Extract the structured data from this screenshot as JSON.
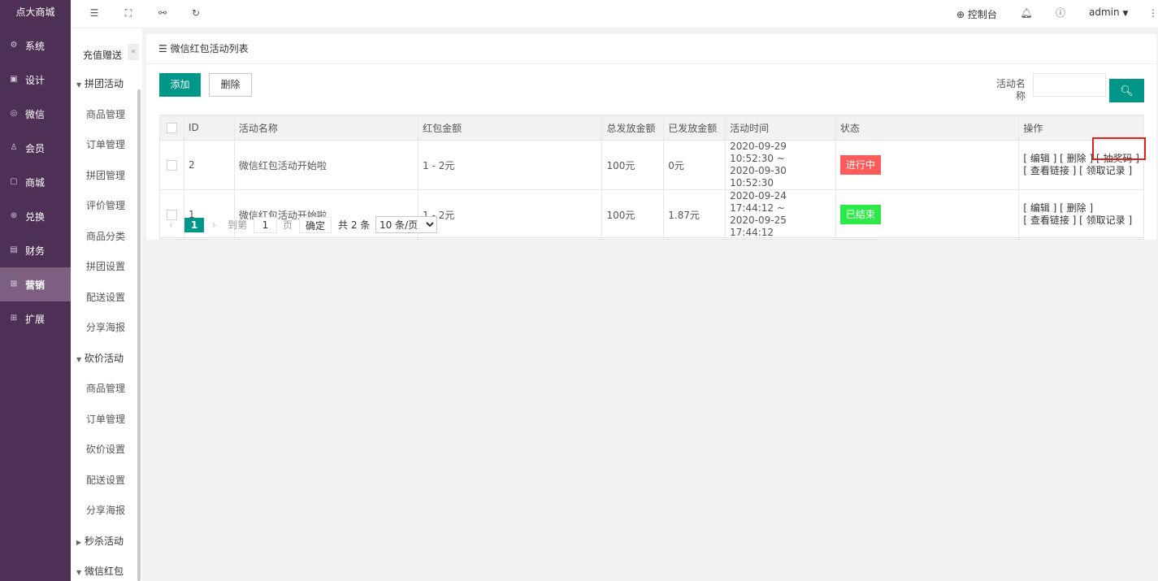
{
  "app": {
    "brand": "点大商城"
  },
  "nav": {
    "items": [
      {
        "label": "系统",
        "icon": "gear-icon",
        "glyph": "⚙"
      },
      {
        "label": "设计",
        "icon": "design-icon",
        "glyph": "▣"
      },
      {
        "label": "微信",
        "icon": "wechat-icon",
        "glyph": "◎"
      },
      {
        "label": "会员",
        "icon": "user-icon",
        "glyph": "♙"
      },
      {
        "label": "商城",
        "icon": "shop-icon",
        "glyph": "▢"
      },
      {
        "label": "兑换",
        "icon": "exchange-icon",
        "glyph": "⊛"
      },
      {
        "label": "财务",
        "icon": "finance-icon",
        "glyph": "▤"
      },
      {
        "label": "营销",
        "icon": "gift-icon",
        "glyph": "⊞"
      },
      {
        "label": "扩展",
        "icon": "apps-icon",
        "glyph": "⊞"
      }
    ],
    "active_index": 7
  },
  "submenu": {
    "top_label": "充值赠送",
    "collapse_glyph": "«",
    "group1": {
      "label": "拼团活动",
      "items": [
        "商品管理",
        "订单管理",
        "拼团管理",
        "评价管理",
        "商品分类",
        "拼团设置",
        "配送设置",
        "分享海报"
      ]
    },
    "group2": {
      "label": "砍价活动",
      "items": [
        "商品管理",
        "订单管理",
        "砍价设置",
        "配送设置",
        "分享海报"
      ]
    },
    "group3": {
      "label": "秒杀活动"
    },
    "group4": {
      "label": "微信红包"
    }
  },
  "topbar": {
    "console_label": "控制台",
    "user_label": "admin"
  },
  "card": {
    "title": "微信红包活动列表",
    "add_label": "添加",
    "delete_label": "删除",
    "search_label": "活动名称",
    "search_value": ""
  },
  "table": {
    "headers": [
      "ID",
      "活动名称",
      "红包金额",
      "总发放金额",
      "已发放金额",
      "活动时间",
      "状态",
      "操作"
    ],
    "rows": [
      {
        "id": "2",
        "name": "微信红包活动开始啦",
        "amount": "1 - 2元",
        "total": "100元",
        "issued": "0元",
        "time_start": "2020-09-29 10:52:30 ~",
        "time_end": "2020-09-30 10:52:30",
        "status": "进行中",
        "status_color": "#ff5722",
        "op_edit": "[ 编辑 ]",
        "op_delete": "[ 删除 ]",
        "op_code": "[ 抽奖码 ]",
        "op_link": "[ 查看链接 ]",
        "op_records": "[ 领取记录 ]"
      },
      {
        "id": "1",
        "name": "微信红包活动开始啦",
        "amount": "1 - 2元",
        "total": "100元",
        "issued": "1.87元",
        "time_start": "2020-09-24 17:44:12 ~",
        "time_end": "2020-09-25 17:44:12",
        "status": "已结束",
        "status_color": "#2ee94a",
        "op_edit": "[ 编辑 ]",
        "op_delete": "[ 删除 ]",
        "op_link": "[ 查看链接 ]",
        "op_records": "[ 领取记录 ]"
      }
    ]
  },
  "pager": {
    "current": "1",
    "goto_label": "到第",
    "goto_value": "1",
    "page_label": "页",
    "confirm_label": "确定",
    "total_label": "共 2 条",
    "page_size": "10 条/页"
  },
  "colors": {
    "sidebar": "#4e3054",
    "accent": "#009688",
    "highlight": "#e02020"
  }
}
